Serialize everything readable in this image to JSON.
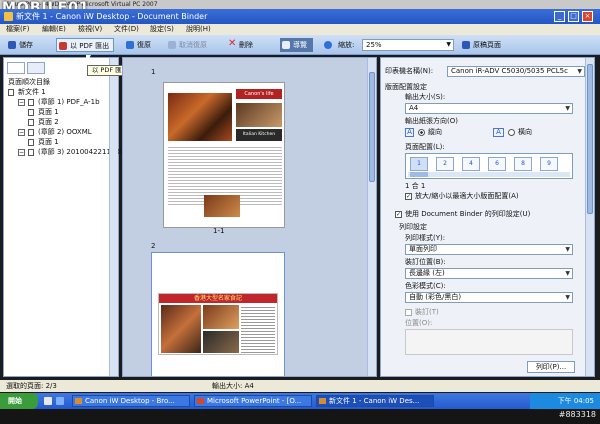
{
  "vpc_title": "Virtual PC — i4WD1 i4WP Microsoft Virtual PC 2007",
  "app_title": "新文件 1 - Canon iW Desktop - Document Binder",
  "menu": [
    "檔案(F)",
    "編輯(E)",
    "檢視(V)",
    "文件(D)",
    "設定(S)",
    "說明(H)"
  ],
  "toolbar": {
    "save": "儲存",
    "pdf_export": "以 PDF 匯出",
    "undo": "復原",
    "redo": "取消復原",
    "delete": "刪除",
    "preview": "導覽",
    "zoom_label": "縮放:",
    "zoom_value": "25%",
    "print_page": "原稿頁面"
  },
  "tooltip": "以 PDF 匯出",
  "left_panel": {
    "root": "頁面順次目錄",
    "items": [
      {
        "label": "新文件 1",
        "level": 0,
        "kind": "doc"
      },
      {
        "label": "(章節 1) PDF_A-1b",
        "level": 1,
        "kind": "section"
      },
      {
        "label": "頁面 1",
        "level": 2,
        "kind": "page"
      },
      {
        "label": "頁面 2",
        "level": 2,
        "kind": "page"
      },
      {
        "label": "(章節 2) OOXML",
        "level": 1,
        "kind": "section"
      },
      {
        "label": "頁面 1",
        "level": 2,
        "kind": "page"
      },
      {
        "label": "(章節 3) 20100422111001",
        "level": 1,
        "kind": "section"
      }
    ]
  },
  "canvas": {
    "page1_number": "1",
    "page1_caption": "1-1",
    "page1_title": "Canon's life",
    "page1_subtitle": "Italian Kitchen",
    "page2_number": "2",
    "page2_title": "香港大型名家食記"
  },
  "right_panel": {
    "printer_label": "印表機名稱(N):",
    "printer_value": "Canon iR-ADV C5030/5035 PCL5c",
    "layout_header": "版面配置設定",
    "output_size_label": "輸出大小(S):",
    "output_size_value": "A4",
    "orientation_label": "輸出紙張方向(O)",
    "orientation_portrait": "縱向",
    "orientation_landscape": "橫向",
    "page_layout_label": "頁面配置(L):",
    "layout_options": [
      "1",
      "2",
      "4",
      "6",
      "8",
      "9"
    ],
    "n_up_text": "1 合 1",
    "enlarge_text": "放大/縮小以最適大小版面配置(A)",
    "use_binder_text": "使用 Document Binder 的列印設定(U)",
    "print_settings_header": "列印設定",
    "print_style_label": "列印樣式(Y):",
    "print_style_value": "單面列印",
    "binding_label": "裝訂位置(B):",
    "binding_value": "長邊緣 (左)",
    "color_label": "色彩模式(C):",
    "color_value": "自動 (彩色/黑白)",
    "staple_label": "裝訂(T)",
    "staple_pos_label": "位置(O):",
    "print_button": "列印(P)..."
  },
  "status": {
    "left": "選取的頁面: 2/3",
    "output_size": "輸出大小: A4"
  },
  "taskbar": {
    "start": "開始",
    "tasks": [
      "Canon iW Desktop - Bro...",
      "Microsoft PowerPoint - [O...",
      "新文件 1 - Canon iW Des..."
    ],
    "clock": "下午 04:05"
  },
  "watermark": "#883318",
  "logo": "MOBILE01"
}
